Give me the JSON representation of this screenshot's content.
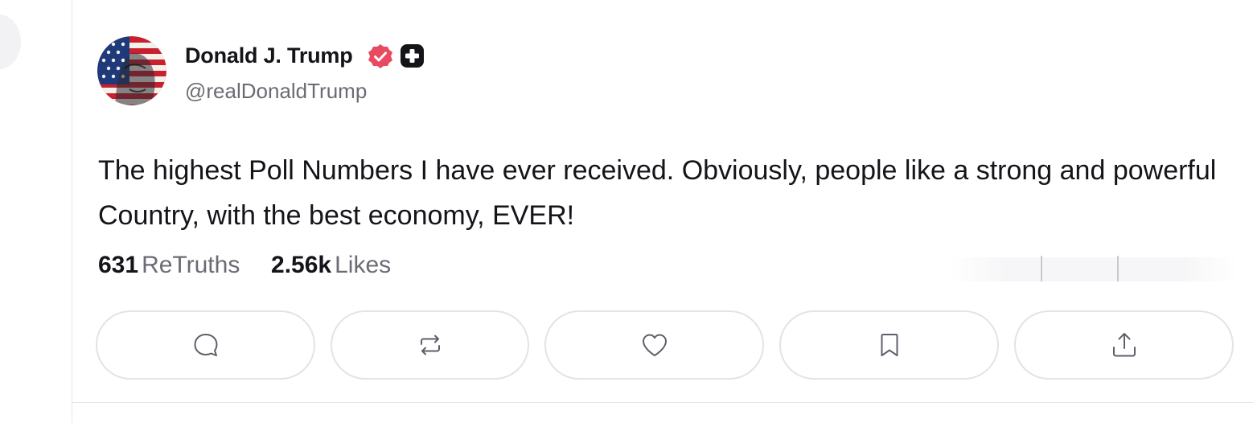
{
  "user": {
    "display_name": "Donald J. Trump",
    "handle": "@realDonaldTrump",
    "verified_icon": "verified-check-icon",
    "badge_icon": "plus-badge-icon"
  },
  "post": {
    "text": "The highest Poll Numbers I have ever received. Obviously, people like a strong and powerful Country, with the best economy, EVER!"
  },
  "stats": {
    "retruths_count": "631",
    "retruths_label": "ReTruths",
    "likes_count": "2.56k",
    "likes_label": "Likes"
  },
  "actions": [
    {
      "name": "reply",
      "icon": "comment-icon"
    },
    {
      "name": "retruth",
      "icon": "repost-icon"
    },
    {
      "name": "like",
      "icon": "heart-icon"
    },
    {
      "name": "bookmark",
      "icon": "bookmark-icon"
    },
    {
      "name": "share",
      "icon": "share-icon"
    }
  ],
  "colors": {
    "verified": "#e84a5f",
    "text": "#141419",
    "muted": "#6b6b75"
  }
}
